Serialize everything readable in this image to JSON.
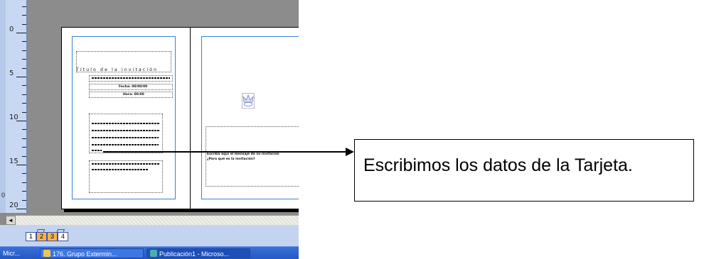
{
  "ruler": {
    "labels": [
      "0",
      "5",
      "10",
      "15",
      "20"
    ],
    "side_mark": "0"
  },
  "publication": {
    "cover_title": "Título de la invitación",
    "front_lines": [
      "Fecha: 00/00/00",
      "Hora: 00:00"
    ],
    "inside_text": [
      "Escriba aquí el mensaje de su invitación",
      "¿Para qué es la invitación?"
    ]
  },
  "page_tabs": [
    {
      "label": "1",
      "active": false
    },
    {
      "label": "2",
      "active": true
    },
    {
      "label": "3",
      "active": true
    },
    {
      "label": "4",
      "active": false
    }
  ],
  "scroll_left_label": "◄",
  "taskbar": {
    "items": [
      {
        "label": "Micr...",
        "icon": "window-icon"
      },
      {
        "label": "176. Grupo Extermin...",
        "icon": "folder-icon"
      },
      {
        "label": "Publicación1 - Microso...",
        "icon": "publisher-icon"
      }
    ]
  },
  "callout": {
    "text": "Escribimos los datos de la Tarjeta."
  },
  "colors": {
    "ruler": "#c9d8f2",
    "margin_guides": "#3b82d6",
    "active_page_tab": "#f8b24c",
    "taskbar": "#2458c4"
  }
}
